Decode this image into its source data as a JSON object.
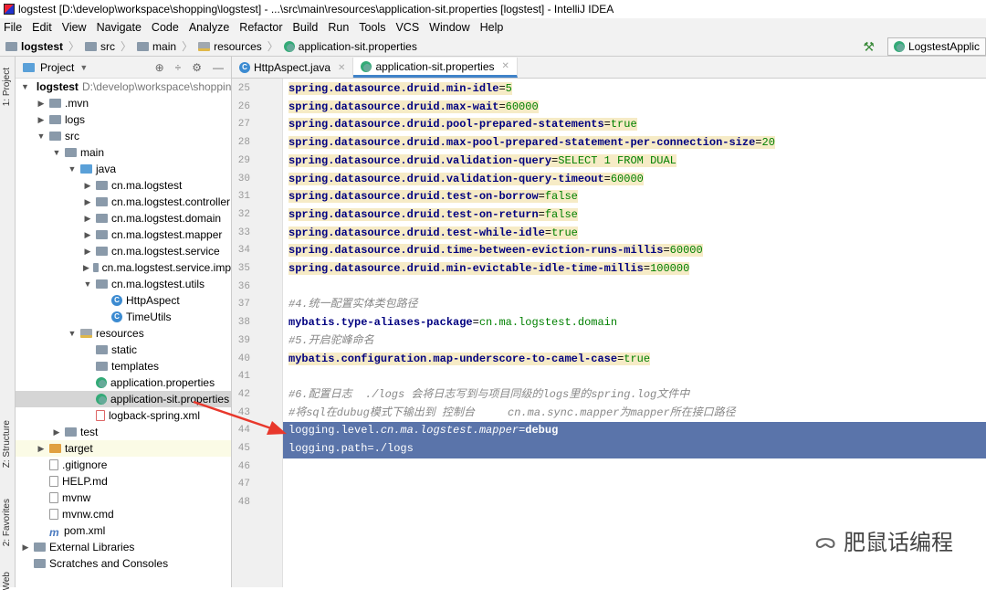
{
  "window_title": "logstest [D:\\develop\\workspace\\shopping\\logstest] - ...\\src\\main\\resources\\application-sit.properties [logstest] - IntelliJ IDEA",
  "menu": [
    "File",
    "Edit",
    "View",
    "Navigate",
    "Code",
    "Analyze",
    "Refactor",
    "Build",
    "Run",
    "Tools",
    "VCS",
    "Window",
    "Help"
  ],
  "breadcrumb": [
    "logstest",
    "src",
    "main",
    "resources",
    "application-sit.properties"
  ],
  "run_config": "LogstestApplic",
  "side_tabs": [
    "1: Project",
    "Z: Structure",
    "2: Favorites",
    "Web"
  ],
  "panel": {
    "title": "Project"
  },
  "tree": [
    {
      "d": 0,
      "a": "▼",
      "i": "fold",
      "t": "logstest",
      "extra": "D:\\develop\\workspace\\shoppin",
      "bold": true
    },
    {
      "d": 1,
      "a": "▶",
      "i": "fold",
      "t": ".mvn"
    },
    {
      "d": 1,
      "a": "▶",
      "i": "fold",
      "t": "logs"
    },
    {
      "d": 1,
      "a": "▼",
      "i": "fold",
      "t": "src"
    },
    {
      "d": 2,
      "a": "▼",
      "i": "fold",
      "t": "main"
    },
    {
      "d": 3,
      "a": "▼",
      "i": "java",
      "t": "java"
    },
    {
      "d": 4,
      "a": "▶",
      "i": "fold",
      "t": "cn.ma.logstest"
    },
    {
      "d": 4,
      "a": "▶",
      "i": "fold",
      "t": "cn.ma.logstest.controller"
    },
    {
      "d": 4,
      "a": "▶",
      "i": "fold",
      "t": "cn.ma.logstest.domain"
    },
    {
      "d": 4,
      "a": "▶",
      "i": "fold",
      "t": "cn.ma.logstest.mapper"
    },
    {
      "d": 4,
      "a": "▶",
      "i": "fold",
      "t": "cn.ma.logstest.service"
    },
    {
      "d": 4,
      "a": "▶",
      "i": "fold",
      "t": "cn.ma.logstest.service.imp"
    },
    {
      "d": 4,
      "a": "▼",
      "i": "fold",
      "t": "cn.ma.logstest.utils"
    },
    {
      "d": 5,
      "a": "",
      "i": "class",
      "t": "HttpAspect"
    },
    {
      "d": 5,
      "a": "",
      "i": "class",
      "t": "TimeUtils"
    },
    {
      "d": 3,
      "a": "▼",
      "i": "res",
      "t": "resources"
    },
    {
      "d": 4,
      "a": "",
      "i": "fold",
      "t": "static"
    },
    {
      "d": 4,
      "a": "",
      "i": "fold",
      "t": "templates"
    },
    {
      "d": 4,
      "a": "",
      "i": "prop",
      "t": "application.properties"
    },
    {
      "d": 4,
      "a": "",
      "i": "prop",
      "t": "application-sit.properties",
      "sel": true
    },
    {
      "d": 4,
      "a": "",
      "i": "xml",
      "t": "logback-spring.xml"
    },
    {
      "d": 2,
      "a": "▶",
      "i": "fold",
      "t": "test"
    },
    {
      "d": 1,
      "a": "▶",
      "i": "orange",
      "t": "target",
      "hl": true
    },
    {
      "d": 1,
      "a": "",
      "i": "file",
      "t": ".gitignore"
    },
    {
      "d": 1,
      "a": "",
      "i": "file",
      "t": "HELP.md"
    },
    {
      "d": 1,
      "a": "",
      "i": "file",
      "t": "mvnw"
    },
    {
      "d": 1,
      "a": "",
      "i": "file",
      "t": "mvnw.cmd"
    },
    {
      "d": 1,
      "a": "",
      "i": "m",
      "t": "pom.xml"
    },
    {
      "d": 0,
      "a": "▶",
      "i": "lib",
      "t": "External Libraries"
    },
    {
      "d": 0,
      "a": "",
      "i": "scratch",
      "t": "Scratches and Consoles"
    }
  ],
  "tabs": [
    {
      "label": "HttpAspect.java",
      "icon": "class"
    },
    {
      "label": "application-sit.properties",
      "icon": "prop",
      "active": true
    }
  ],
  "code": [
    {
      "n": 25,
      "y": true,
      "s": [
        [
          "spring.datasource.druid.min-idle",
          "k"
        ],
        [
          "=",
          "e"
        ],
        [
          "5",
          "v"
        ]
      ]
    },
    {
      "n": 26,
      "y": true,
      "s": [
        [
          "spring.datasource.druid.max-wait",
          "k"
        ],
        [
          "=",
          "e"
        ],
        [
          "60000",
          "v"
        ]
      ]
    },
    {
      "n": 27,
      "y": true,
      "s": [
        [
          "spring.datasource.druid.pool-prepared-statements",
          "k"
        ],
        [
          "=",
          "e"
        ],
        [
          "true",
          "v"
        ]
      ]
    },
    {
      "n": 28,
      "y": true,
      "s": [
        [
          "spring.datasource.druid.max-pool-prepared-statement-per-connection-size",
          "k"
        ],
        [
          "=",
          "e"
        ],
        [
          "20",
          "v"
        ]
      ]
    },
    {
      "n": 29,
      "y": true,
      "s": [
        [
          "spring.datasource.druid.validation-query",
          "k"
        ],
        [
          "=",
          "e"
        ],
        [
          "SELECT 1 FROM DUAL",
          "v"
        ]
      ]
    },
    {
      "n": 30,
      "y": true,
      "s": [
        [
          "spring.datasource.druid.validation-query-timeout",
          "k"
        ],
        [
          "=",
          "e"
        ],
        [
          "60000",
          "v"
        ]
      ]
    },
    {
      "n": 31,
      "y": true,
      "s": [
        [
          "spring.datasource.druid.test-on-borrow",
          "k"
        ],
        [
          "=",
          "e"
        ],
        [
          "false",
          "v"
        ]
      ]
    },
    {
      "n": 32,
      "y": true,
      "s": [
        [
          "spring.datasource.druid.test-on-return",
          "k"
        ],
        [
          "=",
          "e"
        ],
        [
          "false",
          "v"
        ]
      ]
    },
    {
      "n": 33,
      "y": true,
      "s": [
        [
          "spring.datasource.druid.test-while-idle",
          "k"
        ],
        [
          "=",
          "e"
        ],
        [
          "true",
          "v"
        ]
      ]
    },
    {
      "n": 34,
      "y": true,
      "s": [
        [
          "spring.datasource.druid.time-between-eviction-runs-millis",
          "k"
        ],
        [
          "=",
          "e"
        ],
        [
          "60000",
          "v"
        ]
      ]
    },
    {
      "n": 35,
      "y": true,
      "s": [
        [
          "spring.datasource.druid.min-evictable-idle-time-millis",
          "k"
        ],
        [
          "=",
          "e"
        ],
        [
          "100000",
          "v"
        ]
      ]
    },
    {
      "n": 36,
      "s": []
    },
    {
      "n": 37,
      "s": [
        [
          "#4.统一配置实体类包路径",
          "c"
        ]
      ]
    },
    {
      "n": 38,
      "s": [
        [
          "mybatis.type-aliases-package",
          "k"
        ],
        [
          "=",
          "e"
        ],
        [
          "cn.ma.logstest.domain",
          "v"
        ]
      ]
    },
    {
      "n": 39,
      "s": [
        [
          "#5.开启驼峰命名",
          "c"
        ]
      ]
    },
    {
      "n": 40,
      "y": true,
      "s": [
        [
          "mybatis.configuration.map-underscore-to-camel-case",
          "k"
        ],
        [
          "=",
          "e"
        ],
        [
          "true",
          "v"
        ]
      ]
    },
    {
      "n": 41,
      "s": []
    },
    {
      "n": 42,
      "s": [
        [
          "#6.配置日志  ./logs 会将日志写到与项目同级的logs里的spring.log文件中",
          "c"
        ]
      ]
    },
    {
      "n": 43,
      "s": [
        [
          "#将sql在dubug模式下输出到 控制台     cn.ma.sync.mapper为mapper所在接口路径",
          "c"
        ]
      ]
    },
    {
      "n": 44,
      "sel": true,
      "s": [
        [
          "logging.level.",
          "e"
        ],
        [
          "cn.ma.logstest.mapper",
          "i"
        ],
        [
          "=",
          "e"
        ],
        [
          "debug",
          "k"
        ]
      ]
    },
    {
      "n": 45,
      "sel": true,
      "s": [
        [
          "logging.path=./logs",
          "e"
        ]
      ]
    },
    {
      "n": 46,
      "s": []
    },
    {
      "n": 47,
      "s": []
    },
    {
      "n": 48,
      "s": []
    }
  ],
  "watermark": "肥鼠话编程",
  "colors": {
    "selection": "#5a74aa",
    "key": "#000080",
    "value": "#008000",
    "comment": "#888888",
    "highlight": "#f6ebc6",
    "arrow": "#e8382c"
  }
}
